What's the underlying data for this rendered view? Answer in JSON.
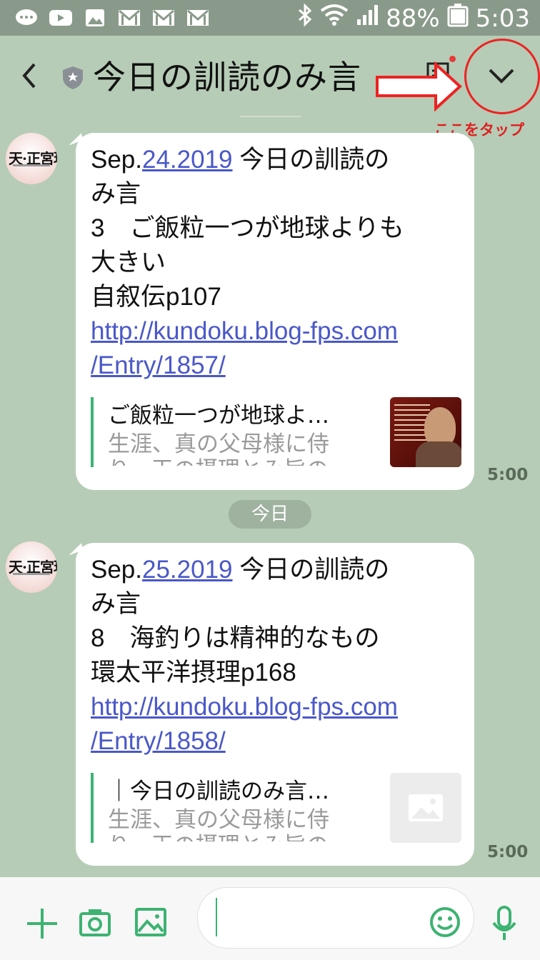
{
  "status_bar": {
    "battery": "88%",
    "time": "5:03",
    "left_icons": [
      "chat-icon",
      "youtube-icon",
      "image-icon",
      "gmail-icon",
      "gmail-icon",
      "gmail-icon"
    ],
    "right_icons": [
      "bluetooth-icon",
      "wifi-icon",
      "signal-icon",
      "battery-icon"
    ]
  },
  "header": {
    "title": "今日の訓読のみ言",
    "annotation": "ここをタップ",
    "colors": {
      "annotation": "#e02020",
      "dot": "#e63a3a"
    }
  },
  "messages": [
    {
      "lines": [
        {
          "prefix": "Sep.",
          "link": "24.2019",
          "suffix": " 今日の訓読の"
        },
        {
          "text": "み言"
        },
        {
          "text": "3　ご飯粒一つが地球よりも"
        },
        {
          "text": "大きい"
        },
        {
          "text": "自叙伝p107"
        }
      ],
      "url_lines": [
        "http://kundoku.blog-fps.com",
        "/Entry/1857/"
      ],
      "preview": {
        "title": "ご飯粒一つが地球よ…",
        "desc": "生涯、真の父母様に侍",
        "desc2": "り、天の摂理とみ旨の"
      },
      "time": "5:00"
    },
    {
      "lines": [
        {
          "prefix": "Sep.",
          "link": "25.2019",
          "suffix": " 今日の訓読の"
        },
        {
          "text": "み言"
        },
        {
          "text": "8　海釣りは精神的なもの"
        },
        {
          "text": "環太平洋摂理p168"
        }
      ],
      "url_lines": [
        "http://kundoku.blog-fps.com",
        "/Entry/1858/"
      ],
      "preview": {
        "title": "｜今日の訓読のみ言…",
        "desc": "生涯、真の父母様に侍",
        "desc2": "り、天の摂理とみ旨の"
      },
      "time": "5:00"
    }
  ],
  "date_chip": "今日",
  "theme": {
    "background": "#b6ccb6",
    "accent": "#3cb371",
    "link": "#4a58c8"
  }
}
